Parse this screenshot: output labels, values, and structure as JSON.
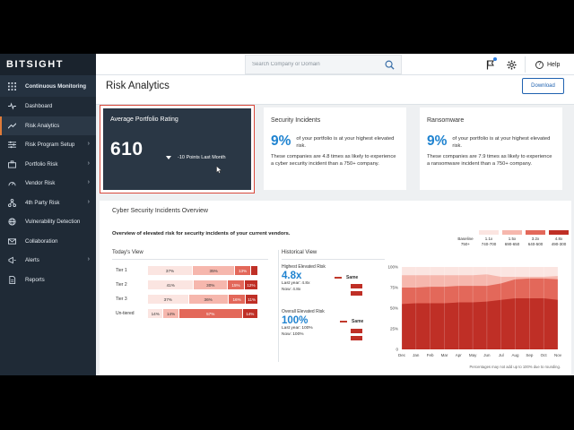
{
  "logo": "BITSIGHT",
  "colors": {
    "sidebar": "#1f2a36",
    "accent": "#1f83d0",
    "highlight": "#d9483b",
    "seg0": "#fbe5e1",
    "seg1": "#f6b7ad",
    "seg2": "#e3685a",
    "seg3": "#bf2f26"
  },
  "sidebar": {
    "items": [
      {
        "label": "Continuous Monitoring",
        "icon": "grid-icon"
      },
      {
        "label": "Dashboard",
        "icon": "pulse-icon"
      },
      {
        "label": "Risk Analytics",
        "icon": "trend-icon"
      },
      {
        "label": "Risk Program Setup",
        "icon": "sliders-icon"
      },
      {
        "label": "Portfolio Risk",
        "icon": "briefcase-icon"
      },
      {
        "label": "Vendor Risk",
        "icon": "speedometer-icon"
      },
      {
        "label": "4th Party Risk",
        "icon": "network-icon"
      },
      {
        "label": "Vulnerability Detection",
        "icon": "globe-icon"
      },
      {
        "label": "Collaboration",
        "icon": "mail-icon"
      },
      {
        "label": "Alerts",
        "icon": "megaphone-icon"
      },
      {
        "label": "Reports",
        "icon": "document-icon"
      }
    ]
  },
  "topbar": {
    "search_placeholder": "Search Company or Domain",
    "help": "Help"
  },
  "page": {
    "title": "Risk Analytics",
    "download": "Download"
  },
  "portfolio": {
    "title": "Average Portfolio Rating",
    "value": "610",
    "change": "-10 Points Last Month"
  },
  "incidents": {
    "title": "Security Incidents",
    "pct": "9%",
    "desc": "of your portfolio is at your highest elevated risk.",
    "more": "These companies are 4.8 times as likely to experience a cyber security incident than a 750+ company."
  },
  "ransomware": {
    "title": "Ransomware",
    "pct": "9%",
    "desc": "of your portfolio is at your highest elevated risk.",
    "more": "These companies are 7.9 times as likely to experience a ransomware incident than a 750+ company."
  },
  "cyber": {
    "title": "Cyber Security Incidents Overview",
    "subtitle": "Overview of elevated risk for security incidents of your current vendors.",
    "legend": [
      {
        "label": "Baseline",
        "range": "750+"
      },
      {
        "label": "1.1x",
        "range": "740-700"
      },
      {
        "label": "1.5x",
        "range": "690-650"
      },
      {
        "label": "3.2x",
        "range": "640-500"
      },
      {
        "label": "4.8x",
        "range": "490-300"
      }
    ],
    "today_title": "Today's View",
    "tiers": [
      {
        "label": "Tier 1",
        "segments": [
          {
            "label": "37%",
            "value": 37
          },
          {
            "label": "35%",
            "value": 35
          },
          {
            "label": "13%",
            "value": 13
          },
          {
            "label": "",
            "value": 6
          }
        ]
      },
      {
        "label": "Tier 2",
        "segments": [
          {
            "label": "41%",
            "value": 41
          },
          {
            "label": "30%",
            "value": 30
          },
          {
            "label": "15%",
            "value": 15
          },
          {
            "label": "12%",
            "value": 12
          }
        ]
      },
      {
        "label": "Tier 3",
        "segments": [
          {
            "label": "37%",
            "value": 37
          },
          {
            "label": "36%",
            "value": 36
          },
          {
            "label": "16%",
            "value": 16
          },
          {
            "label": "11%",
            "value": 11
          }
        ]
      },
      {
        "label": "Un-tiered",
        "segments": [
          {
            "label": "14%",
            "value": 14
          },
          {
            "label": "14%",
            "value": 14
          },
          {
            "label": "57%",
            "value": 57
          },
          {
            "label": "14%",
            "value": 14
          }
        ]
      }
    ],
    "historical_title": "Historical View",
    "highest": {
      "label": "Highest Elevated Risk",
      "value": "4.8x",
      "last_year": "Last year: 4.8x",
      "now": "Now: 4.8x",
      "trend": "Same"
    },
    "overall": {
      "label": "Overall Elevated Risk",
      "value": "100%",
      "last_year": "Last year: 100%",
      "now": "Now: 100%",
      "trend": "Same"
    },
    "footnote": "Percentages may not add up to 100% due to rounding."
  },
  "chart_data": {
    "type": "area",
    "x": [
      "Dec",
      "Jan",
      "Feb",
      "Mar",
      "Apr",
      "May",
      "Jun",
      "Jul",
      "Aug",
      "Sep",
      "Oct",
      "Nov"
    ],
    "ylim": [
      0,
      100
    ],
    "yticks": [
      "0",
      "25%",
      "50%",
      "75%",
      "100%"
    ],
    "series": [
      {
        "values": [
          55,
          56,
          56,
          56,
          57,
          57,
          58,
          60,
          62,
          62,
          62,
          60
        ]
      },
      {
        "values": [
          75,
          75,
          76,
          76,
          77,
          77,
          77,
          80,
          85,
          86,
          86,
          85
        ]
      },
      {
        "values": [
          90,
          90,
          90,
          90,
          90,
          90,
          91,
          88,
          88,
          88,
          88,
          89
        ]
      },
      {
        "values": [
          100,
          100,
          100,
          100,
          100,
          100,
          100,
          100,
          100,
          100,
          100,
          100
        ]
      }
    ]
  }
}
